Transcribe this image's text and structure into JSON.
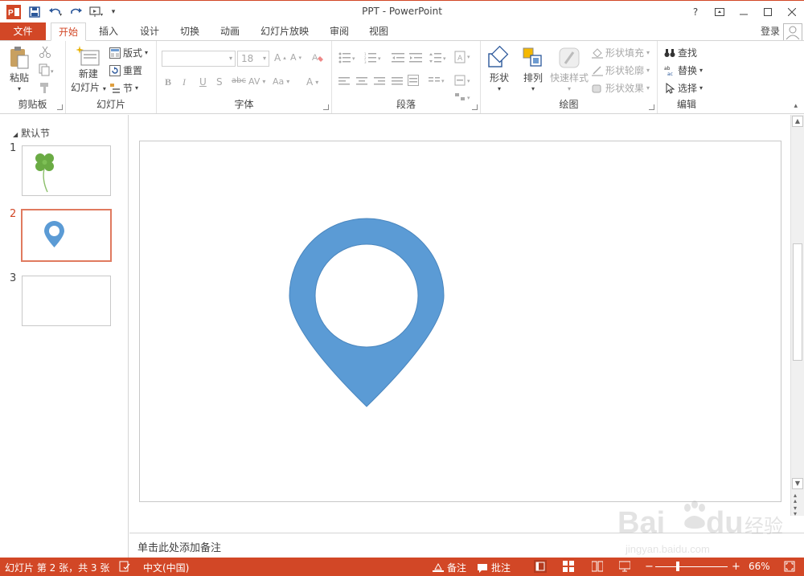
{
  "app": {
    "title": "PPT - PowerPoint",
    "help": "?",
    "accent": "#d24726"
  },
  "tabs": {
    "file": "文件",
    "items": [
      "开始",
      "插入",
      "设计",
      "切换",
      "动画",
      "幻灯片放映",
      "审阅",
      "视图"
    ],
    "active_index": 0,
    "login": "登录"
  },
  "ribbon": {
    "clipboard": {
      "paste": "粘贴",
      "label": "剪贴板"
    },
    "slides": {
      "new_slide_1": "新建",
      "new_slide_2": "幻灯片",
      "layout": "版式",
      "reset": "重置",
      "section": "节",
      "label": "幻灯片"
    },
    "font": {
      "font_name": "",
      "font_size": "18",
      "label": "字体"
    },
    "paragraph": {
      "label": "段落"
    },
    "drawing": {
      "shapes": "形状",
      "arrange": "排列",
      "quick_styles": "快速样式",
      "shape_fill": "形状填充",
      "shape_outline": "形状轮廓",
      "shape_effects": "形状效果",
      "label": "绘图"
    },
    "editing": {
      "find": "查找",
      "replace": "替换",
      "select": "选择",
      "label": "编辑"
    }
  },
  "slides_pane": {
    "section_name": "默认节",
    "slides": [
      {
        "number": "1",
        "content": "clover"
      },
      {
        "number": "2",
        "content": "location-pin",
        "selected": true
      },
      {
        "number": "3",
        "content": "blank"
      }
    ]
  },
  "slide": {
    "shape": "location-pin",
    "shape_color": "#5b9bd5"
  },
  "notes": {
    "placeholder": "单击此处添加备注"
  },
  "statusbar": {
    "slide_info": "幻灯片 第 2 张，共 3 张",
    "language": "中文(中国)",
    "notes": "备注",
    "comments": "批注",
    "zoom": "66%"
  },
  "watermark": {
    "brand": "Bai du 经验",
    "url": "jingyan.baidu.com"
  }
}
